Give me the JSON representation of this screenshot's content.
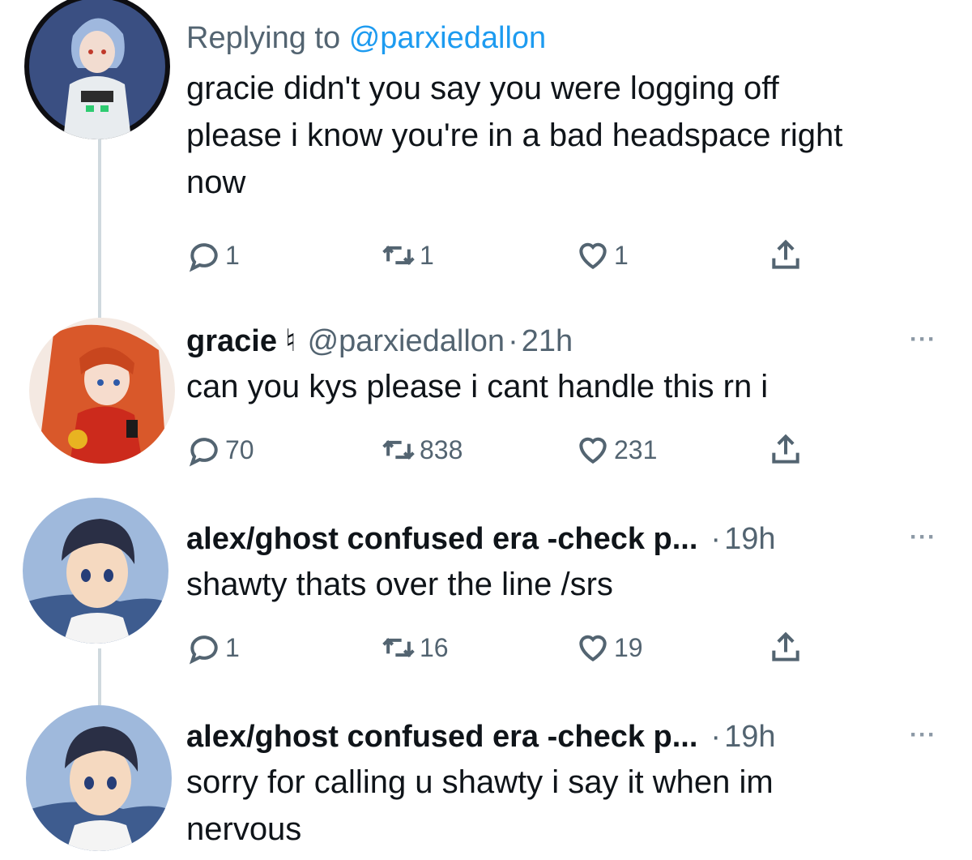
{
  "tweets": [
    {
      "replying_prefix": "Replying to",
      "replying_handle": "@parxiedallon",
      "text_lines": [
        "gracie didn't you say you were logging off",
        "please i know you're in a bad headspace right",
        "now"
      ],
      "actions": {
        "replies": "1",
        "retweets": "1",
        "likes": "1"
      }
    },
    {
      "name": "gracie",
      "badge": "♮",
      "handle": "@parxiedallon",
      "separator": "·",
      "time": "21h",
      "text_lines": [
        "can you kys please i cant handle this rn i"
      ],
      "actions": {
        "replies": "70",
        "retweets": "838",
        "likes": "231"
      }
    },
    {
      "name": "alex/ghost confused era -check p...",
      "separator": "·",
      "time": "19h",
      "text_lines": [
        "shawty thats over the line /srs"
      ],
      "actions": {
        "replies": "1",
        "retweets": "16",
        "likes": "19"
      }
    },
    {
      "name": "alex/ghost confused era -check p...",
      "separator": "·",
      "time": "19h",
      "text_lines": [
        "sorry for calling u shawty i say it when im",
        "nervous"
      ]
    }
  ],
  "more_label": "···",
  "icons": {
    "reply": "reply-icon",
    "retweet": "retweet-icon",
    "like": "heart-icon",
    "share": "share-icon",
    "more": "more-options-icon"
  },
  "colors": {
    "link": "#1d9bf0",
    "secondary_text": "#536471",
    "thread_line": "#cfd9de"
  }
}
